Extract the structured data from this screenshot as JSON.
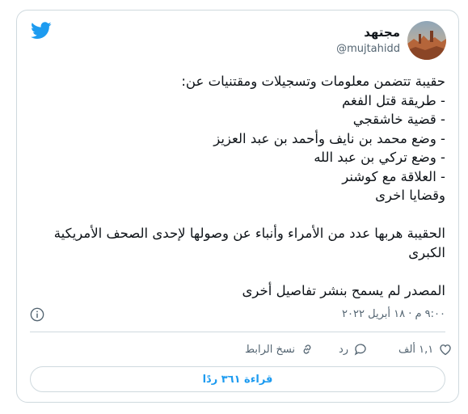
{
  "author": {
    "display_name": "مجتهد",
    "handle": "@mujtahidd"
  },
  "tweet": {
    "text": "حقيبة تتضمن معلومات وتسجيلات ومقتنيات عن:\n- طريقة قتل الفغم\n- قضية خاشقجي\n- وضع محمد بن نايف وأحمد بن عبد العزيز\n- وضع تركي بن عبد الله\n- العلاقة مع كوشنر\nوقضايا اخرى\n\nالحقيبة هربها عدد من الأمراء وأنباء عن وصولها لإحدى الصحف الأمريكية الكبرى\n\nالمصدر لم يسمح بنشر تفاصيل أخرى",
    "timestamp": "٩:٠٠ م · ١٨ أبريل ٢٠٢٢"
  },
  "actions": {
    "like_count": "١,١ ألف",
    "reply_label": "رد",
    "copy_link_label": "نسخ الرابط"
  },
  "footer": {
    "read_replies_label": "قراءة ٣٦١ ردًا"
  },
  "colors": {
    "twitter_blue": "#1d9bf0",
    "secondary_text": "#536471",
    "border": "#cfd9de"
  },
  "icons": [
    "twitter-bird-icon",
    "info-icon",
    "heart-icon",
    "reply-bubble-icon",
    "link-icon"
  ]
}
